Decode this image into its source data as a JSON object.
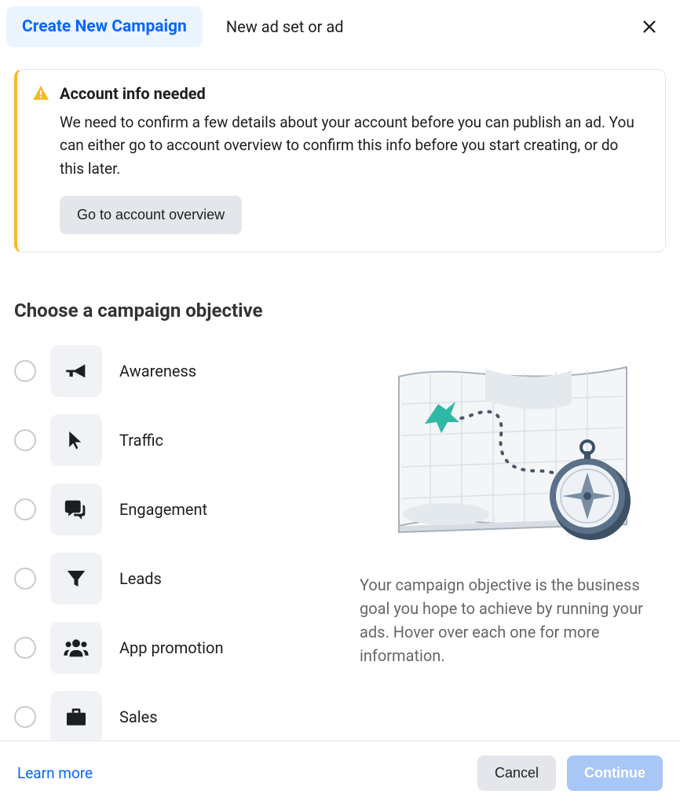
{
  "header": {
    "tabs": [
      {
        "label": "Create New Campaign",
        "active": true
      },
      {
        "label": "New ad set or ad",
        "active": false
      }
    ]
  },
  "alert": {
    "title": "Account info needed",
    "body": "We need to confirm a few details about your account before you can publish an ad. You can either go to account overview to confirm this info before you start creating, or do this later.",
    "button_label": "Go to account overview"
  },
  "section_title": "Choose a campaign objective",
  "objectives": [
    {
      "id": "awareness",
      "label": "Awareness",
      "icon": "megaphone-icon"
    },
    {
      "id": "traffic",
      "label": "Traffic",
      "icon": "cursor-icon"
    },
    {
      "id": "engagement",
      "label": "Engagement",
      "icon": "chat-icon"
    },
    {
      "id": "leads",
      "label": "Leads",
      "icon": "funnel-icon"
    },
    {
      "id": "app-promotion",
      "label": "App promotion",
      "icon": "people-icon"
    },
    {
      "id": "sales",
      "label": "Sales",
      "icon": "briefcase-icon"
    }
  ],
  "side_panel": {
    "description": "Your campaign objective is the business goal you hope to achieve by running your ads. Hover over each one for more information."
  },
  "footer": {
    "learn_more": "Learn more",
    "cancel": "Cancel",
    "continue": "Continue"
  }
}
